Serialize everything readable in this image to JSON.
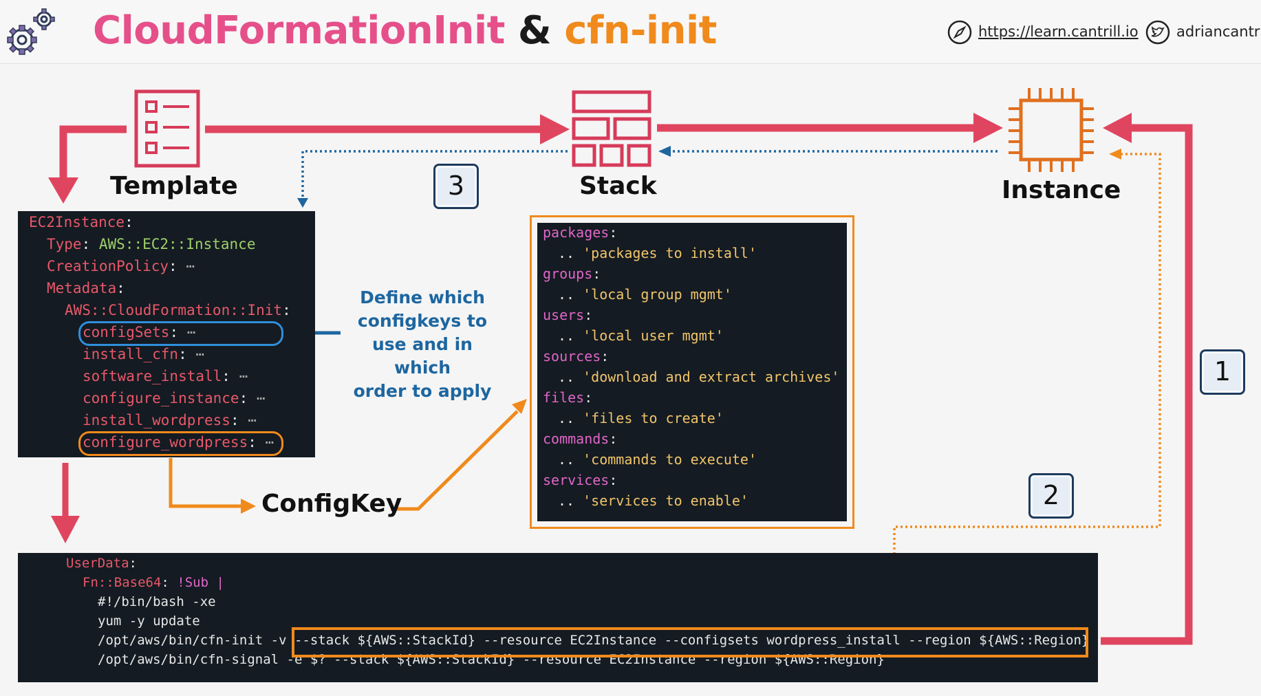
{
  "header": {
    "title_part1": "CloudFormationInit",
    "title_amp": "&",
    "title_part2": "cfn-init",
    "link": "https://learn.cantrill.io",
    "handle": "adriancantrill"
  },
  "labels": {
    "template": "Template",
    "stack": "Stack",
    "instance": "Instance",
    "configkey": "ConfigKey",
    "define_note": [
      "Define which",
      "configkeys to",
      "use and in which",
      "order  to apply"
    ],
    "step1": "1",
    "step2": "2",
    "step3": "3"
  },
  "template_code": {
    "l1": "EC2Instance",
    "l2_key": "Type",
    "l2_val": "AWS::EC2::Instance",
    "l3": "CreationPolicy",
    "l4": "Metadata",
    "l5": "AWS::CloudFormation::Init",
    "l6": "configSets",
    "l7": "install_cfn",
    "l8": "software_install",
    "l9": "configure_instance",
    "l10": "install_wordpress",
    "l11": "configure_wordpress",
    "colon": ":",
    "ellipsis": "⋯"
  },
  "config_code": {
    "k1": "packages",
    "v1": "'packages to install'",
    "k2": "groups",
    "v2": "'local group mgmt'",
    "k3": "users",
    "v3": "'local user mgmt'",
    "k4": "sources",
    "v4": "'download and extract archives'",
    "k5": "files",
    "v5": "'files to create'",
    "k6": "commands",
    "v6": "'commands to execute'",
    "k7": "services",
    "v7": "'services to enable'",
    "dots": "..",
    "colon": ":"
  },
  "userdata_code": {
    "l1": "UserData",
    "l2_fn": "Fn::Base64",
    "l2_sub": "!Sub |",
    "l3": "#!/bin/bash -xe",
    "l4": "yum -y update",
    "l5_cmd": "/opt/aws/bin/cfn-init -v ",
    "l5_args": "--stack ${AWS::StackId} --resource EC2Instance --configsets wordpress_install --region ${AWS::Region}",
    "l6": "/opt/aws/bin/cfn-signal -e $? --stack ${AWS::StackId} --resource EC2Instance --region ${AWS::Region}",
    "colon": ":"
  },
  "colors": {
    "pink": "#e5508a",
    "orange": "#f08a1c",
    "red_arrow": "#e04560",
    "blue": "#1d66a0",
    "instance_orange": "#e0701e",
    "code_bg": "#141b22"
  }
}
